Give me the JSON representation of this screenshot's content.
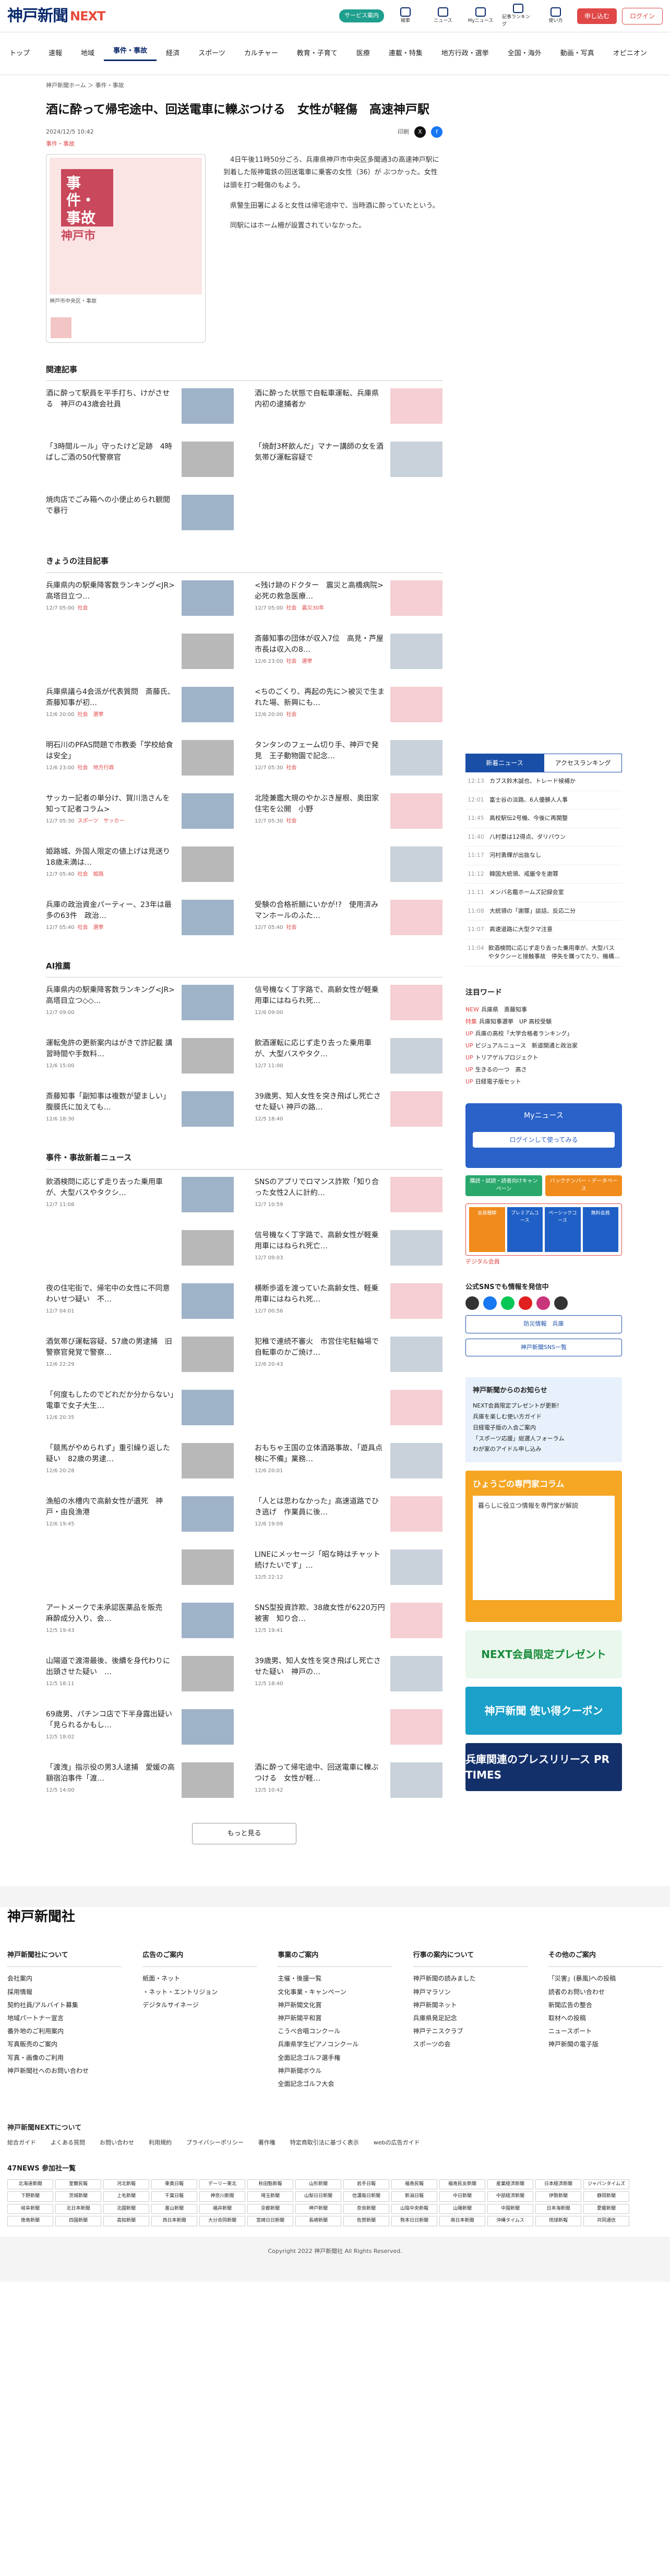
{
  "header": {
    "logo": "神戸新聞",
    "logo_next": "NEXT",
    "pill": "サービス案内",
    "icons": [
      "検索",
      "ニュース",
      "Myニュース",
      "記事ランキング",
      "使い方"
    ],
    "signup": "申し込む",
    "login": "ログイン"
  },
  "nav": [
    "トップ",
    "速報",
    "地域",
    "事件・事故",
    "経済",
    "スポーツ",
    "カルチャー",
    "教育・子育て",
    "医療",
    "連載・特集",
    "地方行政・選挙",
    "全国・海外",
    "動画・写真",
    "オピニオン"
  ],
  "breadcrumb": "神戸新聞ホーム ＞ 事件・事故",
  "article": {
    "title": "酒に酔って帰宅途中、回送電車に轢ぶつける　女性が軽傷　高速神戸駅",
    "date": "2024/12/5 10:42",
    "print": "印刷",
    "category": "事件・事故",
    "photo_tag": "事件・事故",
    "photo_city": "神戸市",
    "caption": "神戸市中央区・事故",
    "paragraphs": [
      "4日午後11時50分ごろ、兵庫県神戸市中央区多聞通3の高速神戸駅に到着した阪神電鉄の回送電車に乗客の女性（36）が ぶつかった。女性は頭を打つ軽傷のもよう。",
      "県警生田署によると女性は帰宅途中で、当時酒に酔っていたという。",
      "同駅にはホーム柵が設置されていなかった。"
    ]
  },
  "related": {
    "title": "関連記事",
    "items": [
      {
        "t": "酒に酔って駅員を平手打ち、けがさせる　神戸の43歳会社員"
      },
      {
        "t": "酒に酔った状態で自転車運転、兵庫県内初の逮捕者か"
      },
      {
        "t": "「3時間ルール」守ったけど足跡　4時ばしご酒の50代警察官"
      },
      {
        "t": "「焼酎3杯飲んだ」マナー講師の女を酒気帯び運転容疑で"
      },
      {
        "t": "焼肉店でごみ箱への小便止められ観閲で暴行"
      }
    ]
  },
  "today": {
    "title": "きょうの注目記事",
    "items": [
      {
        "t": "兵庫県内の駅乗降客数ランキング<JR> 高塔目立つ…",
        "m": "12/7 05:00",
        "c": "社会"
      },
      {
        "t": "<残け跡のドクター　震災と高橋病院>必死の救急医療…",
        "m": "12/7 05:00",
        "c": "社会　震災30年"
      },
      {
        "t": "",
        "m": "",
        "c": ""
      },
      {
        "t": "斎藤知事の団体が収入7位　高見・芦屋市長は収入の8…",
        "m": "12/6 23:00",
        "c": "社会　選挙"
      },
      {
        "t": "兵庫県議ら4会派が代表質問　斎藤氏、斎藤知事が初…",
        "m": "12/6 20:00",
        "c": "社会　選挙"
      },
      {
        "t": "<ちのごくり、再起の先に＞被災で生まれた場、新興にも…",
        "m": "12/6 20:00",
        "c": "社会"
      },
      {
        "t": "明石川のPFAS問題で市教委「学校給食は安全」",
        "m": "12/6 23:00",
        "c": "社会　地方行政"
      },
      {
        "t": "タンタンのフェーム切り手、神戸で発見　王子動物園で記念…",
        "m": "12/7 05:30",
        "c": "社会"
      },
      {
        "t": "サッカー記者の単分け、賀川浩さんを知って記者コラム>",
        "m": "12/7 05:30",
        "c": "スポーツ　サッカー"
      },
      {
        "t": "北陸兼鑑大規のやかぶき屋根、奥田家住宅を公開　小野",
        "m": "12/7 05:30",
        "c": "社会"
      },
      {
        "t": "姫路城、外国人限定の値上げは見送り　18歳未満は…",
        "m": "12/7 05:40",
        "c": "社会　姫路"
      },
      {
        "t": "",
        "m": "",
        "c": ""
      },
      {
        "t": "兵庫の政治資金パーティー、23年は最多の63件　政治…",
        "m": "12/7 05:40",
        "c": "社会　選挙"
      },
      {
        "t": "受験の合格祈願にいかが!?　使用済みマンホールのふた…",
        "m": "12/7 05:40",
        "c": "社会"
      }
    ]
  },
  "ai": {
    "title": "AI推薦",
    "items": [
      {
        "t": "兵庫県内の駅乗降客数ランキング<JR> 高塔目立つ◇◇…",
        "m": "12/7 09:00"
      },
      {
        "t": "信号機なく丁字路で、高齢女性が軽乗用車にはねられ死…",
        "m": "12/6 09:00"
      },
      {
        "t": "運転免許の更新案内はがきで詐記載 講習時間や手数料…",
        "m": "12/6 15:00"
      },
      {
        "t": "飲酒運転に応じず走り去った乗用車が、大型バスやタク…",
        "m": "12/7 11:00"
      },
      {
        "t": "斎藤知事「副知事は複数が望ましい」腹膜氏に加えても…",
        "m": "12/6 18:30"
      },
      {
        "t": "39歳男、知人女性を突き飛ばし死亡させた疑い 神戸の路…",
        "m": "12/5 18:40"
      }
    ]
  },
  "jiken": {
    "title": "事件・事故新着ニュース",
    "items": [
      {
        "t": "飲酒検問に応じず走り去った乗用車が、大型バスやタクシ…",
        "m": "12/7 11:08"
      },
      {
        "t": "SNSのアプリでロマンス詐欺「知り合った女性2人に計約…",
        "m": "12/7 10:59"
      },
      {
        "t": "",
        "m": ""
      },
      {
        "t": "信号機なく丁字路で、高齢女性が軽乗用車にはねられ死亡…",
        "m": "12/7 09:03"
      },
      {
        "t": "夜の住宅街で、帰宅中の女性に不同意わいせつ疑い　不…",
        "m": "12/7 04:01"
      },
      {
        "t": "横断歩道を渡っていた高齢女性、軽乗用車にはねられ死…",
        "m": "12/7 00:56"
      },
      {
        "t": "酒気帯び運転容疑、57歳の男逮捕　旧警察官発覚で警察…",
        "m": "12/6 22:29"
      },
      {
        "t": "犯稚で連続不審火　市営住宅駐輪場で自転車のかご焼け…",
        "m": "12/6 20:43"
      },
      {
        "t": "「何度もしたのでどれだか分からない」電車で女子大生…",
        "m": "12/6 20:35"
      },
      {
        "t": "",
        "m": ""
      },
      {
        "t": "「競馬がやめられず」重引繰り返した疑い　82歳の男逮…",
        "m": "12/6 20:28"
      },
      {
        "t": "おもちゃ王国の立体酒路事故、「遊具点検に不備」業務…",
        "m": "12/6 20:01"
      },
      {
        "t": "漁船の水槽内で高齢女性が遺死　神戸・由良漁港",
        "m": "12/6 19:45"
      },
      {
        "t": "「人とは思わなかった」高速道路でひき逃げ　作業員に後…",
        "m": "12/6 19:09"
      },
      {
        "t": "",
        "m": ""
      },
      {
        "t": "LINEにメッセージ「昭な時はチャット続けたいです」…",
        "m": "12/5 22:12"
      },
      {
        "t": "アートメークで未承認医薬品を販売　麻酔成分入り、会…",
        "m": "12/5 19:43"
      },
      {
        "t": "SNS型投資詐欺、38歳女性が6220万円被害　知り合…",
        "m": "12/5 19:41"
      },
      {
        "t": "山陽道で渡滞最後、後續を身代わりに出頭させた疑い　…",
        "m": "12/5 18:11"
      },
      {
        "t": "39歳男、知人女性を突き飛ばし死亡させた疑い　神戸の…",
        "m": "12/5 18:40"
      },
      {
        "t": "69歳男、パチンコ店で下半身露出疑い「見られるかもし…",
        "m": "12/5 18:02"
      },
      {
        "t": "",
        "m": ""
      },
      {
        "t": "「渡洩」指示役の男3人逮捕　愛媛の高額宿泊事件「渡…",
        "m": "12/5 14:00"
      },
      {
        "t": "酒に酔って帰宅途中、回送電車に轢ぶつける　女性が軽…",
        "m": "12/5 10:42"
      }
    ]
  },
  "more": "もっと見る",
  "sidebar": {
    "tabs": [
      "新着ニュース",
      "アクセスランキング"
    ],
    "rank": [
      {
        "time": "12:13",
        "t": "カブス鈴木誠也、トレード候補か"
      },
      {
        "time": "12:01",
        "t": "富士谷の淡路、6人優勝人人事"
      },
      {
        "time": "11:45",
        "t": "高校駅伝2号機、今後に再開整"
      },
      {
        "time": "11:40",
        "t": "八村塁は12得点、ダリバウン"
      },
      {
        "time": "11:17",
        "t": "河村勇輝が出抜なし"
      },
      {
        "time": "11:12",
        "t": "韓国大統領、戒厳令を謝罪"
      },
      {
        "time": "11:11",
        "t": "メンバ名鑑ホームズ記録会室"
      },
      {
        "time": "11:08",
        "t": "大統領の「謝罪」談話、反応二分"
      },
      {
        "time": "11:07",
        "t": "高速道路に大型クマ注意"
      },
      {
        "time": "11:04",
        "t": "飲酒検問に応じず走り去った乗用車が、大型バスやタクシーと接触事故　停失を購ってたり、機構…"
      }
    ],
    "kw_title": "注目ワード",
    "kw": [
      {
        "b": "NEW",
        "t": "兵庫県　斎藤知事"
      },
      {
        "b": "特集",
        "t": "兵庫知事選挙　UP 高校受験"
      },
      {
        "b": "UP",
        "t": "兵庫の高校「大学合格者ランキング」"
      },
      {
        "b": "UP",
        "t": "ビジュアルニュース　新道開通と政治家"
      },
      {
        "b": "UP",
        "t": "トリアゲルプロジェクト"
      },
      {
        "b": "UP",
        "t": "生きるの一つ　高さ"
      },
      {
        "b": "UP",
        "t": "日経電子版セット"
      }
    ],
    "my_title": "Myニュース",
    "my_login": "ログインして使ってみる",
    "promo": [
      "購読・試読・読者向けキャンペーン",
      "バックナンバー・データベース"
    ],
    "digital": "デジタル会員",
    "digital_items": [
      "会員種類",
      "プレミアムコース",
      "ベーシックコース",
      "無料会員"
    ],
    "sns_title": "公式SNSでも情報を発信中",
    "sns_btn1": "防災情報　兵庫",
    "sns_btn2": "神戸新聞SNS一覧",
    "notice_title": "神戸新聞からのお知らせ",
    "notice": [
      "NEXT会員限定プレゼントが更新!",
      "兵庫を楽しむ使い方ガイド",
      "日経電子版の入会ご案内",
      "「スポーツ応援」総選人フォーラム",
      "わが家のアイドル申し込み"
    ],
    "orange_title": "ひょうごの専門家コラム",
    "orange_body": "暮らしに役立つ情報を専門家が解説",
    "ad1": "NEXT会員限定プレゼント",
    "ad2": "神戸新聞 使い得クーポン",
    "ad3": "兵庫関連のプレスリリース PR TIMES"
  },
  "footer": {
    "logo": "神戸新聞社",
    "cols": [
      {
        "h": "神戸新聞社について",
        "items": [
          "会社案内",
          "採用情報",
          "契約社員/アルバイト募集",
          "地域パートナー宣言",
          "番外地のご利用案内",
          "写真販売のご案内",
          "写真・画像のご利用",
          "神戸新聞社へのお問い合わせ"
        ]
      },
      {
        "h": "広告のご案内",
        "items": [
          "紙面・ネット",
          "・ネット・エントリジョン",
          "デジタルサイネージ"
        ]
      },
      {
        "h": "事業のご案内",
        "items": [
          "主催・後援一覧",
          "文化事業・キャンペーン",
          "神戸新聞文化賞",
          "神戸新聞平和賞",
          "こうべ合唱コンクール",
          "兵庫県学生ピアノコンクール",
          "全面記念ゴルフ選手権",
          "神戸新聞ボウル",
          "全面記念ゴルフ大会"
        ]
      },
      {
        "h": "行事の案内について",
        "items": [
          "神戸新聞の読みました",
          "神戸マラソン",
          "神戸新聞ネット",
          "兵庫県発足記念",
          "神戸テニスクラブ",
          "スポーツの会"
        ]
      },
      {
        "h": "その他のご案内",
        "items": [
          "「災害」(暴風)への投稿",
          "読者のお問い合わせ",
          "新聞広告の整合",
          "取材への投稿",
          "ニュースポート",
          "神戸新聞の電子版"
        ]
      }
    ],
    "next_title": "神戸新聞NEXTについて",
    "next_links": [
      "総合ガイド",
      "よくある質問",
      "お問い合わせ",
      "利用規約",
      "プライバシーポリシー",
      "著作権",
      "特定商取引法に基づく表示",
      "webの広告ガイド"
    ],
    "n47_title": "47NEWS 参加社一覧",
    "n47": [
      "北海道新聞",
      "室蘭民報",
      "河北新報",
      "東奥日報",
      "デーリー東北",
      "秋田魁新報",
      "山形新聞",
      "岩手日報",
      "福島民報",
      "福島民友新聞",
      "産業経済新聞",
      "日本経済新聞",
      "ジャパンタイムズ",
      "下野新聞",
      "茨城新聞",
      "上毛新聞",
      "千葉日報",
      "神奈川新聞",
      "埼玉新聞",
      "山梨日日新聞",
      "信濃毎日新聞",
      "新潟日報",
      "中日新聞",
      "中部経済新聞",
      "伊勢新聞",
      "静岡新聞",
      "岐阜新聞",
      "北日本新聞",
      "北國新聞",
      "富山新聞",
      "福井新聞",
      "京都新聞",
      "神戸新聞",
      "奈良新聞",
      "山陰中央新報",
      "山陽新聞",
      "中国新聞",
      "日本海新聞",
      "愛媛新聞",
      "徳島新聞",
      "四国新聞",
      "高知新聞",
      "西日本新聞",
      "大分合同新聞",
      "宮崎日日新聞",
      "長崎新聞",
      "佐賀新聞",
      "熊本日日新聞",
      "南日本新聞",
      "沖縄タイムス",
      "琉球新報",
      "共同通信"
    ],
    "copy": "Copyright 2022 神戸新聞社 All Rights Reserved."
  }
}
